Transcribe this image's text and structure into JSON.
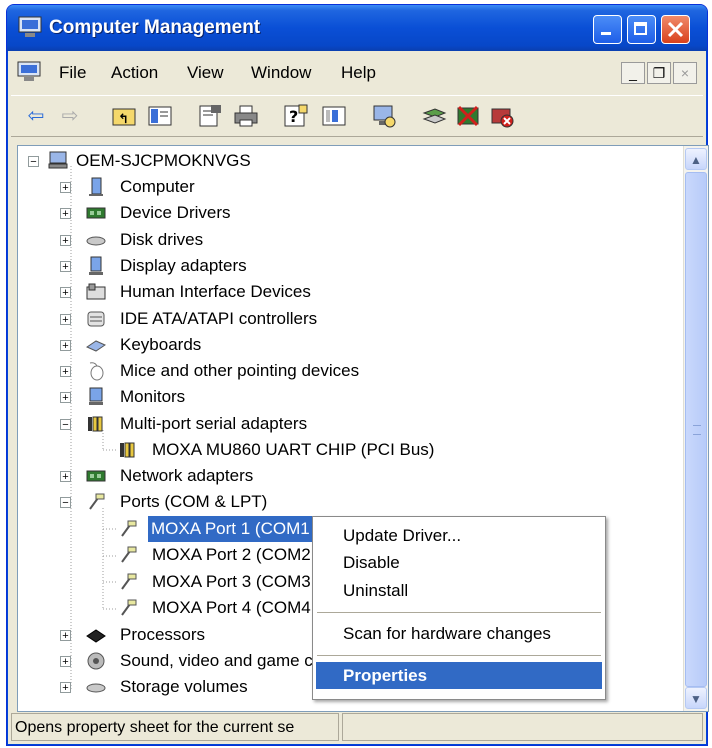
{
  "window": {
    "title": "Computer Management"
  },
  "menu": [
    "File",
    "Action",
    "View",
    "Window",
    "Help"
  ],
  "mdi_controls": {
    "minimize": "_",
    "restore": "❐",
    "close": "×"
  },
  "toolbar": [
    "back-icon",
    "forward-icon",
    "up-folder-icon",
    "show-hide-tree-icon",
    "properties-icon",
    "print-icon",
    "help-icon",
    "view-icon",
    "scan-icon",
    "update-driver-icon",
    "disable-icon",
    "uninstall-icon"
  ],
  "tree": {
    "root": "OEM-SJCPMOKNVGS",
    "items": [
      {
        "label": "Computer",
        "exp": "+"
      },
      {
        "label": "Device Drivers",
        "exp": "+"
      },
      {
        "label": "Disk drives",
        "exp": "+"
      },
      {
        "label": "Display adapters",
        "exp": "+"
      },
      {
        "label": "Human Interface Devices",
        "exp": "+"
      },
      {
        "label": "IDE ATA/ATAPI controllers",
        "exp": "+"
      },
      {
        "label": "Keyboards",
        "exp": "+"
      },
      {
        "label": "Mice and other pointing devices",
        "exp": "+"
      },
      {
        "label": "Monitors",
        "exp": "+"
      },
      {
        "label": "Multi-port serial adapters",
        "exp": "−"
      },
      {
        "label": "MOXA MU860 UART CHIP (PCI Bus)",
        "child": true
      },
      {
        "label": "Network adapters",
        "exp": "+"
      },
      {
        "label": "Ports (COM & LPT)",
        "exp": "−"
      },
      {
        "label": "MOXA Port 1 (COM1",
        "child": true,
        "selected": true
      },
      {
        "label": "MOXA Port 2 (COM2",
        "child": true
      },
      {
        "label": "MOXA Port 3 (COM3",
        "child": true
      },
      {
        "label": "MOXA Port 4 (COM4",
        "child": true
      },
      {
        "label": "Processors",
        "exp": "+"
      },
      {
        "label": "Sound, video and game c",
        "exp": "+"
      },
      {
        "label": "Storage volumes",
        "exp": "+"
      }
    ]
  },
  "context_menu": {
    "update_driver": "Update Driver...",
    "disable": "Disable",
    "uninstall": "Uninstall",
    "scan": "Scan for hardware changes",
    "properties": "Properties"
  },
  "status": {
    "text": "Opens property sheet for the current se"
  }
}
